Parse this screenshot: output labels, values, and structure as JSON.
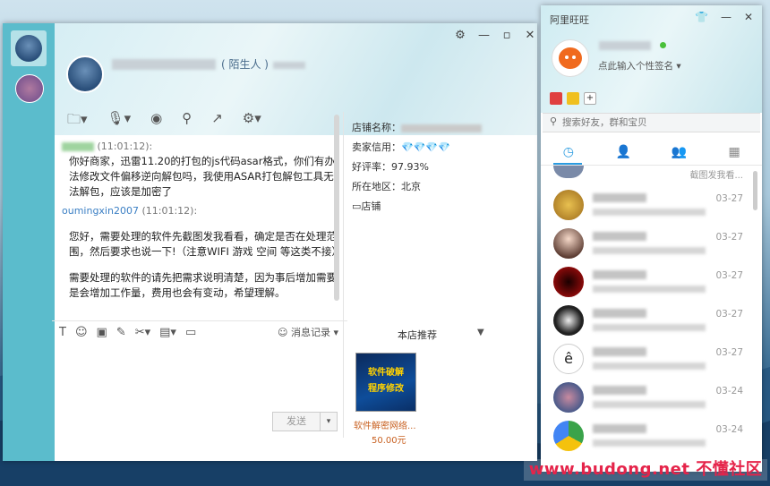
{
  "chat": {
    "header": {
      "tag": "( 陌生人 )"
    },
    "messages": [
      {
        "time": "(11:01:12):",
        "text": "你好商家，迅雷11.20的打包的js代码asar格式，你们有办法修改文件偏移逆向解包吗，我使用ASAR打包解包工具无法解包，应该是加密了"
      },
      {
        "sender": "oumingxin2007",
        "time": "(11:01:12):",
        "text": "您好，需要处理的软件先截图发我看看，确定是否在处理范围，然后要求也说一下!（注意WIFI 游戏 空间 等这类不接）"
      },
      {
        "text": "需要处理的软件的请先把需求说明清楚，因为事后增加需要是会增加工作量，费用也会有变动，希望理解。"
      }
    ],
    "input_toolbar": {
      "history_label": "消息记录"
    },
    "send_label": "发送",
    "shop": {
      "name_label": "店铺名称：",
      "credit_label": "卖家信用：",
      "credit_icons": "💎💎💎💎",
      "rating": "好评率：97.93%",
      "location": "所在地区：北京",
      "store_link": "店铺",
      "recommend_title": "本店推荐",
      "product": {
        "banner_line1": "软件破解",
        "banner_line2": "程序修改",
        "name": "软件解密网络...",
        "price": "50.00元"
      }
    }
  },
  "buddy": {
    "title": "阿里旺旺",
    "signature": "点此输入个性签名",
    "search_placeholder": "搜索好友，群和宝贝",
    "first_snippet": "截图发我看...",
    "contacts": [
      {
        "date": "03-27",
        "color": "#c8962c"
      },
      {
        "date": "03-27",
        "color": "#d9a4a4"
      },
      {
        "date": "03-27",
        "color": "#7a0a0a"
      },
      {
        "date": "03-27",
        "color": "#333333"
      },
      {
        "date": "03-27",
        "color": "#ffffff"
      },
      {
        "date": "03-24",
        "color": "#8a7aa0"
      },
      {
        "date": "03-24",
        "color": "#3aa34a"
      }
    ]
  },
  "watermark": "www.budong.net 不懂社区",
  "colors": {
    "sidebar": "#5bbccc",
    "link": "#3b7fc4",
    "accent": "#2a9be0",
    "price": "#c86020"
  }
}
